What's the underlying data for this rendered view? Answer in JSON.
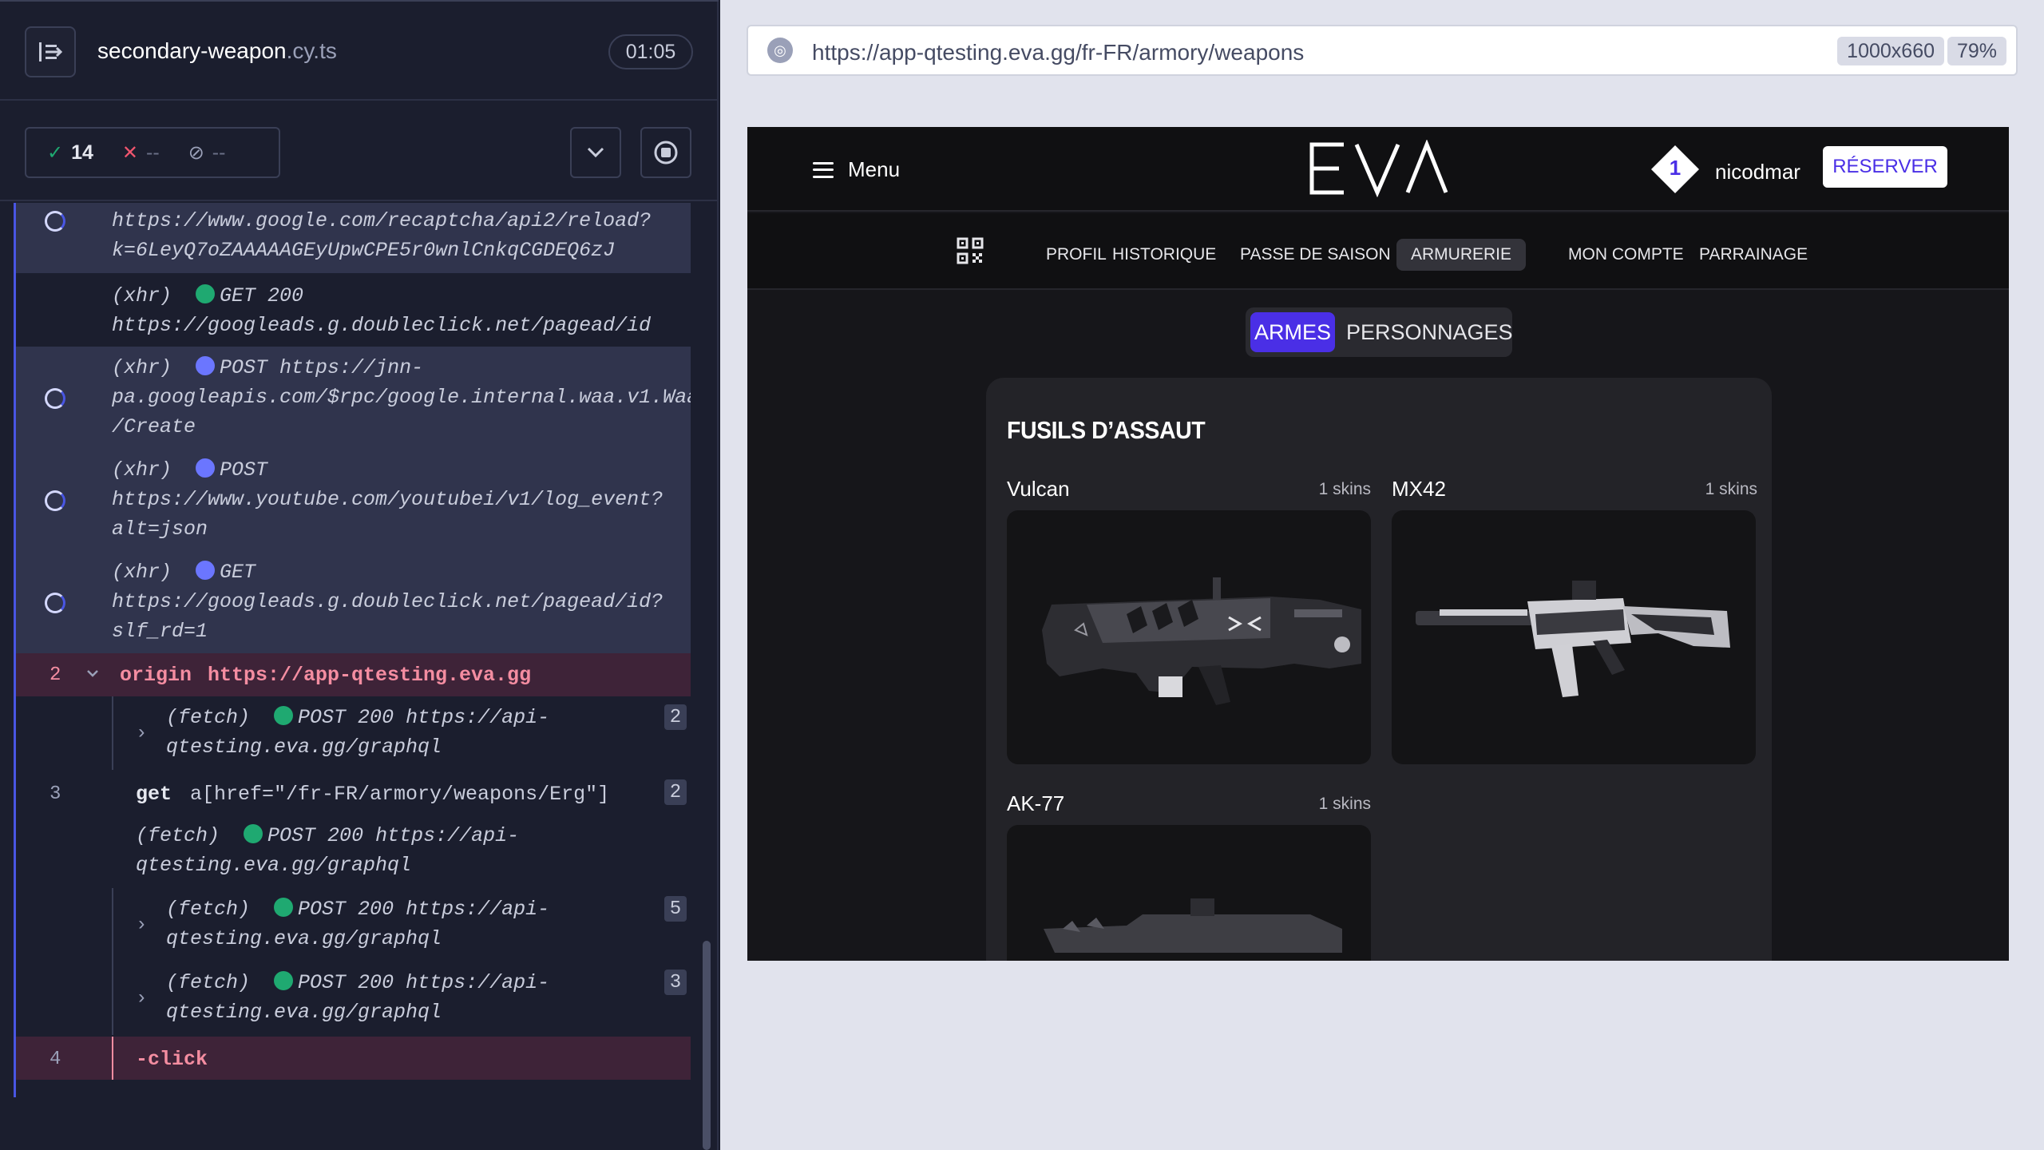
{
  "runner": {
    "spec_name": "secondary-weapon",
    "spec_ext": ".cy.ts",
    "duration": "01:05",
    "stats": {
      "passed": "14",
      "failed": "--",
      "pending": "--"
    }
  },
  "command_log": {
    "r1": {
      "line1": "https://www.google.com/recaptcha/api2/reload?",
      "line2": "k=6LeyQ7oZAAAAAGEyUpwCPE5r0wnlCnkqCGDEQ6zJ"
    },
    "r2": {
      "lbl": "(xhr)",
      "req": "GET 200",
      "line2": "https://googleads.g.doubleclick.net/pagead/id"
    },
    "r3": {
      "lbl": "(xhr)",
      "req": "POST https://jnn-",
      "line2": "pa.googleapis.com/$rpc/google.internal.waa.v1.Waa",
      "line3": "/Create"
    },
    "r4": {
      "lbl": "(xhr)",
      "req": "POST",
      "line2": "https://www.youtube.com/youtubei/v1/log_event?",
      "line3": "alt=json"
    },
    "r5": {
      "lbl": "(xhr)",
      "req": "GET",
      "line2": "https://googleads.g.doubleclick.net/pagead/id?",
      "line3": "slf_rd=1"
    },
    "origin": {
      "num": "2",
      "kw": "origin",
      "url": "https://app-qtesting.eva.gg"
    },
    "f1": {
      "lbl": "(fetch)",
      "req": "POST 200 https://api-",
      "line2": "qtesting.eva.gg/graphql",
      "count": "2"
    },
    "get": {
      "num": "3",
      "kw": "get",
      "sel": "a[href=\"/fr-FR/armory/weapons/Erg\"]",
      "count": "2"
    },
    "f2": {
      "lbl": "(fetch)",
      "req": "POST 200 https://api-",
      "line2": "qtesting.eva.gg/graphql"
    },
    "f3": {
      "lbl": "(fetch)",
      "req": "POST 200 https://api-",
      "line2": "qtesting.eva.gg/graphql",
      "count": "5"
    },
    "f4": {
      "lbl": "(fetch)",
      "req": "POST 200 https://api-",
      "line2": "qtesting.eva.gg/graphql",
      "count": "3"
    },
    "click": {
      "num": "4",
      "kw": "-click"
    }
  },
  "browser": {
    "url": "https://app-qtesting.eva.gg/fr-FR/armory/weapons",
    "viewport": "1000x660",
    "zoom": "79%"
  },
  "eva": {
    "menu_label": "Menu",
    "logo": "EVA",
    "user_level": "1",
    "username": "nicodmar",
    "reserve_label": "RÉSERVER",
    "nav": [
      "PROFIL",
      "HISTORIQUE",
      "PASSE DE SAISON",
      "ARMURERIE",
      "MON COMPTE",
      "PARRAINAGE"
    ],
    "active_nav": "ARMURERIE",
    "toggle": {
      "weapons": "ARMES",
      "characters": "PERSONNAGES"
    },
    "category_title": "FUSILS D’ASSAUT",
    "weapons": [
      {
        "name": "Vulcan",
        "skins": "1 skins"
      },
      {
        "name": "MX42",
        "skins": "1 skins"
      },
      {
        "name": "AK-77",
        "skins": "1 skins"
      }
    ],
    "colors": {
      "accent": "#4a2fe6",
      "bg": "#16161a",
      "card": "#232328"
    }
  }
}
